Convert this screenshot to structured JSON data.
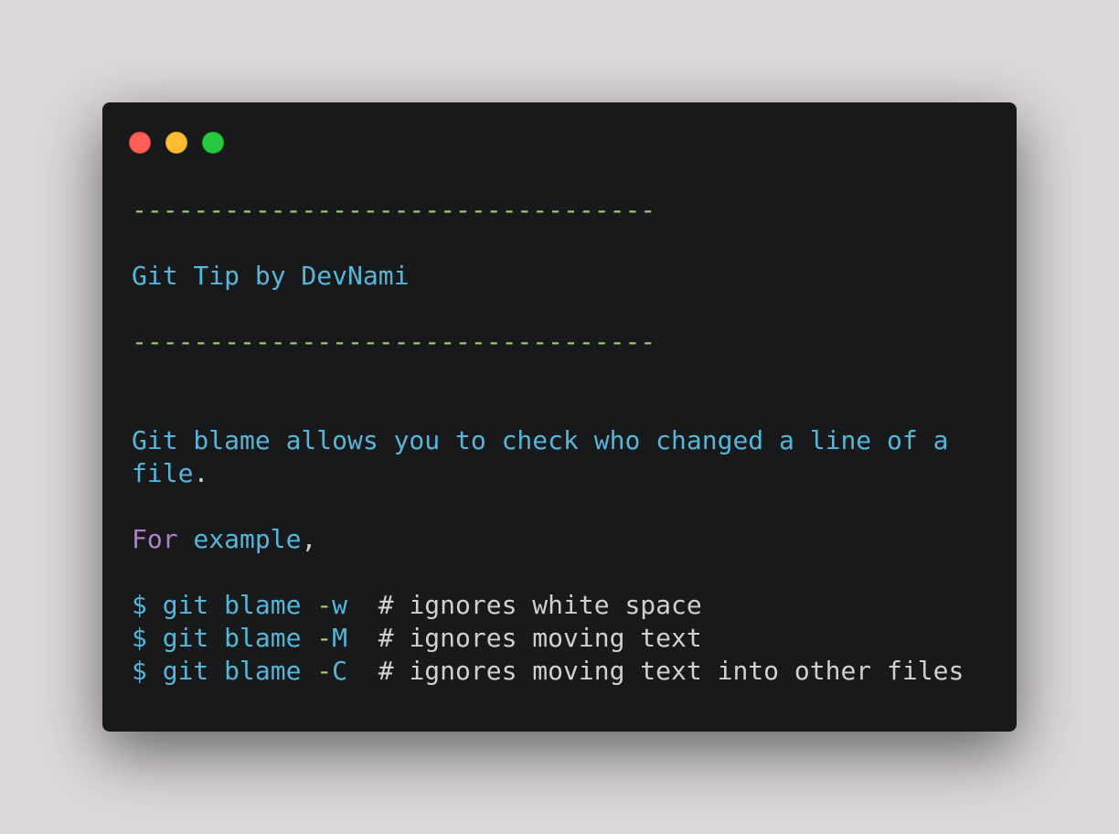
{
  "window": {
    "background": "#18191b",
    "traffic_lights": [
      {
        "name": "close",
        "color": "#ff5f57"
      },
      {
        "name": "minimize",
        "color": "#febc2e"
      },
      {
        "name": "maximize",
        "color": "#28c840"
      }
    ]
  },
  "colors": {
    "dash": "#9ccc65",
    "text": "#56b6d9",
    "keyword": "#b080c8",
    "comment": "#d0d0d0",
    "flag": "#a6d15c"
  },
  "content": {
    "divider": "----------------------------------",
    "title": "Git Tip by DevNami",
    "paragraph_line1": "Git blame allows you to check who changed a line of a",
    "paragraph_line2_word": "file",
    "paragraph_line2_punct": ".",
    "example_keyword": "For",
    "example_word": " example",
    "example_punct": ",",
    "commands": [
      {
        "prompt": "$ git blame ",
        "dash": "-",
        "flag": "w",
        "comment": "  # ignores white space"
      },
      {
        "prompt": "$ git blame ",
        "dash": "-",
        "flag": "M",
        "comment": "  # ignores moving text"
      },
      {
        "prompt": "$ git blame ",
        "dash": "-",
        "flag": "C",
        "comment": "  # ignores moving text into other files"
      }
    ]
  }
}
